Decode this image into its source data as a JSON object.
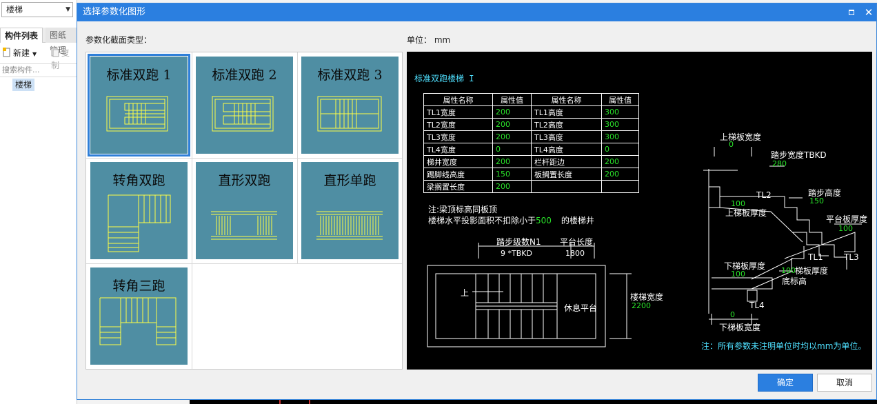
{
  "background": {
    "category_select": "楼梯",
    "tabs": [
      "构件列表",
      "图纸管理"
    ],
    "toolbar": {
      "new_label": "新建",
      "copy_label": "复制"
    },
    "search_placeholder": "搜索构件...",
    "tree_item": "楼梯"
  },
  "dialog": {
    "title": "选择参数化图形",
    "types_label": "参数化截面类型：",
    "unit_label": "单位：  mm",
    "ok_label": "确定",
    "cancel_label": "取消",
    "types": [
      {
        "name": "标准双跑 1",
        "selected": true
      },
      {
        "name": "标准双跑 2",
        "selected": false
      },
      {
        "name": "标准双跑 3",
        "selected": false
      },
      {
        "name": "转角双跑",
        "selected": false
      },
      {
        "name": "直形双跑",
        "selected": false
      },
      {
        "name": "直形单跑",
        "selected": false
      },
      {
        "name": "转角三跑",
        "selected": false
      }
    ]
  },
  "preview": {
    "title": "标准双跑楼梯 I",
    "table": {
      "headers": [
        "属性名称",
        "属性值",
        "属性名称",
        "属性值"
      ],
      "rows": [
        [
          "TL1宽度",
          "200",
          "TL1高度",
          "300"
        ],
        [
          "TL2宽度",
          "200",
          "TL2高度",
          "300"
        ],
        [
          "TL3宽度",
          "200",
          "TL3高度",
          "300"
        ],
        [
          "TL4宽度",
          "0",
          "TL4高度",
          "0"
        ],
        [
          "梯井宽度",
          "200",
          "栏杆距边",
          "200"
        ],
        [
          "踢脚线高度",
          "150",
          "板搁置长度",
          "200"
        ],
        [
          "梁搁置长度",
          "200",
          "",
          ""
        ]
      ]
    },
    "note1": "注:梁顶标高同板顶",
    "note2_pre": "楼梯水平投影面积不扣除小于",
    "note2_val": "500",
    "note2_post": "的楼梯井",
    "plan": {
      "steps_label": "踏步级数N1",
      "steps_value": "9  *TBKD",
      "landing_label": "平台长度",
      "landing_value": "1800",
      "up_label": "上",
      "rest_label": "休息平台",
      "width_label": "楼梯宽度",
      "width_value": "2200"
    },
    "section": {
      "top_slab_width_label": "上梯板宽度",
      "top_slab_width_value": "0",
      "tread_width_label": "踏步宽度TBKD",
      "tread_width_value": "280",
      "riser_label": "踏步高度",
      "riser_value": "150",
      "platform_thick_label": "平台板厚度",
      "platform_thick_value": "100",
      "top_slab_thick_label": "上梯板厚度",
      "top_slab_thick_value": "100",
      "bottom_slab_thick_label": "下梯板厚度",
      "bottom_slab_thick_value": "100",
      "stair_slab_thick_label": "梯板厚度",
      "stair_slab_thick_value": "100",
      "bottom_elev_label": "底标高",
      "bottom_slab_width_label": "下梯板宽度",
      "bottom_slab_width_value": "0",
      "tl1": "TL1",
      "tl2": "TL2",
      "tl3": "TL3",
      "tl4": "TL4"
    },
    "footer_note": "注：所有参数未注明单位时均以mm为单位。"
  },
  "colors": {
    "accent": "#2b7fe0",
    "thumb_bg": "#4f8ea3",
    "cad_yellow": "#ffff44",
    "cad_green": "#29e329",
    "cad_cyan": "#4fe0ff"
  }
}
